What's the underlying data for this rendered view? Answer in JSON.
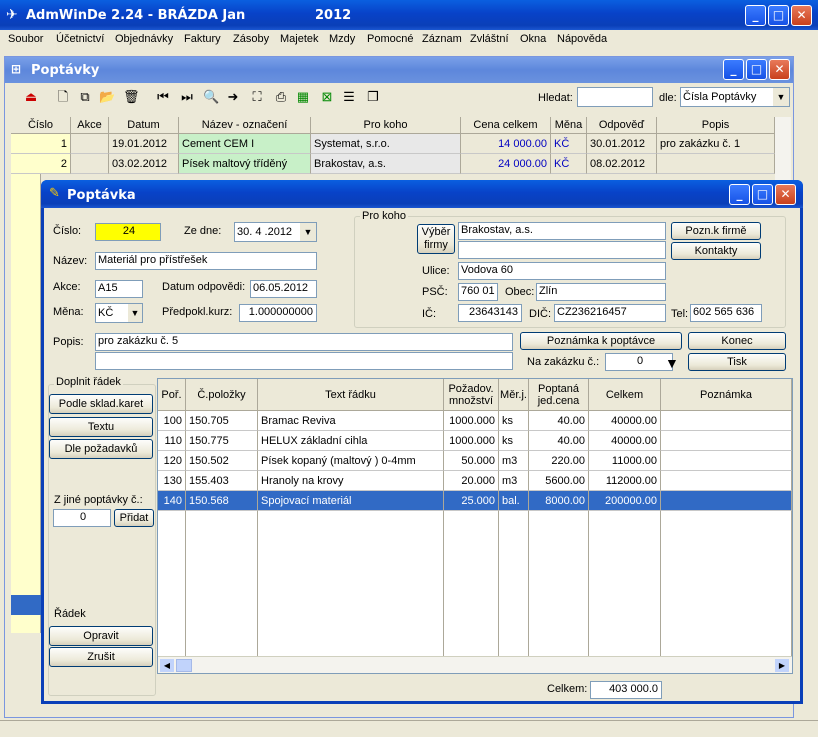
{
  "app": {
    "title": "AdmWinDe 2.24 - BRÁZDA Jan",
    "year": "2012"
  },
  "menu": [
    "Soubor",
    "Účetnictví",
    "Objednávky",
    "Faktury",
    "Zásoby",
    "Majetek",
    "Mzdy",
    "Pomocné",
    "Záznam",
    "Zvláštní",
    "Okna",
    "Nápověda"
  ],
  "list_window": {
    "title": "Poptávky",
    "search_label": "Hledat:",
    "search_value": "",
    "by_label": "dle:",
    "by_value": "Čísla Poptávky",
    "columns": [
      "Číslo",
      "Akce",
      "Datum",
      "Název - označení",
      "Pro koho",
      "Cena celkem",
      "Měna",
      "Odpověď",
      "Popis"
    ],
    "rows": [
      {
        "cislo": "1",
        "akce": "",
        "datum": "19.01.2012",
        "nazev": "Cement CEM I",
        "prokoho": "Systemat, s.r.o.",
        "cena": "14 000.00",
        "mena": "KČ",
        "odpoved": "30.01.2012",
        "popis": "pro zakázku č. 1"
      },
      {
        "cislo": "2",
        "akce": "",
        "datum": "03.02.2012",
        "nazev": "Písek maltový tříděný",
        "prokoho": "Brakostav, a.s.",
        "cena": "24 000.00",
        "mena": "KČ",
        "odpoved": "08.02.2012",
        "popis": ""
      }
    ]
  },
  "detail": {
    "title": "Poptávka",
    "cislo_label": "Číslo:",
    "cislo": "24",
    "zedne_label": "Ze dne:",
    "zedne": "30. 4 .2012",
    "nazev_label": "Název:",
    "nazev": "Materiál pro přístřešek",
    "akce_label": "Akce:",
    "akce": "A15",
    "datum_odp_label": "Datum odpovědi:",
    "datum_odp": "06.05.2012",
    "mena_label": "Měna:",
    "mena": "KČ",
    "kurz_label": "Předpokl.kurz:",
    "kurz": "1.000000000",
    "prokoho_label": "Pro koho",
    "vyber_firmy": "Výběr firmy",
    "firma1": "Brakostav, a.s.",
    "firma2": "",
    "pozn_firme": "Pozn.k firmě",
    "kontakty": "Kontakty",
    "ulice_label": "Ulice:",
    "ulice": "Vodova 60",
    "psc_label": "PSČ:",
    "psc": "760 01",
    "obec_label": "Obec:",
    "obec": "Zlín",
    "ic_label": "IČ:",
    "ic": "23643143",
    "dic_label": "DIČ:",
    "dic": "CZ236216457",
    "tel_label": "Tel:",
    "tel": "602 565 636",
    "popis_label": "Popis:",
    "popis1": "pro zakázku č. 5",
    "popis2": "",
    "poznamka_btn": "Poznámka k poptávce",
    "konec": "Konec",
    "nazakazku_label": "Na zakázku č.:",
    "nazakazku": "0",
    "tisk": "Tisk",
    "doplnit_label": "Doplnit řádek",
    "podle_sklad": "Podle sklad.karet",
    "textu": "Textu",
    "dle_pozadavku": "Dle požadavků",
    "zjine_label": "Z jiné poptávky č.:",
    "zjine": "0",
    "pridat": "Přidat",
    "radek_label": "Řádek",
    "opravit": "Opravit",
    "zrusit": "Zrušit",
    "celkem_label": "Celkem:",
    "celkem": "403 000.0",
    "columns": [
      "Poř.",
      "Č.položky",
      "Text řádku",
      "Požadov. množství",
      "Měr.j.",
      "Poptaná jed.cena",
      "Celkem",
      "Poznámka"
    ],
    "rows": [
      {
        "por": "100",
        "pol": "150.705",
        "text": "Bramac Reviva",
        "mnoz": "1000.000",
        "mj": "ks",
        "cena": "40.00",
        "celkem": "40000.00",
        "pozn": ""
      },
      {
        "por": "110",
        "pol": "150.775",
        "text": "HELUX základní cihla",
        "mnoz": "1000.000",
        "mj": "ks",
        "cena": "40.00",
        "celkem": "40000.00",
        "pozn": ""
      },
      {
        "por": "120",
        "pol": "150.502",
        "text": "Písek kopaný (maltový ) 0-4mm",
        "mnoz": "50.000",
        "mj": "m3",
        "cena": "220.00",
        "celkem": "11000.00",
        "pozn": ""
      },
      {
        "por": "130",
        "pol": "155.403",
        "text": "Hranoly na krovy",
        "mnoz": "20.000",
        "mj": "m3",
        "cena": "5600.00",
        "celkem": "112000.00",
        "pozn": ""
      },
      {
        "por": "140",
        "pol": "150.568",
        "text": "Spojovací materiál",
        "mnoz": "25.000",
        "mj": "bal.",
        "cena": "8000.00",
        "celkem": "200000.00",
        "pozn": ""
      }
    ]
  },
  "colors": {
    "selected": "#316ac5",
    "yellow": "#ffff00",
    "green_cell": "#c8f0c8",
    "blue_text": "#0000c0"
  }
}
